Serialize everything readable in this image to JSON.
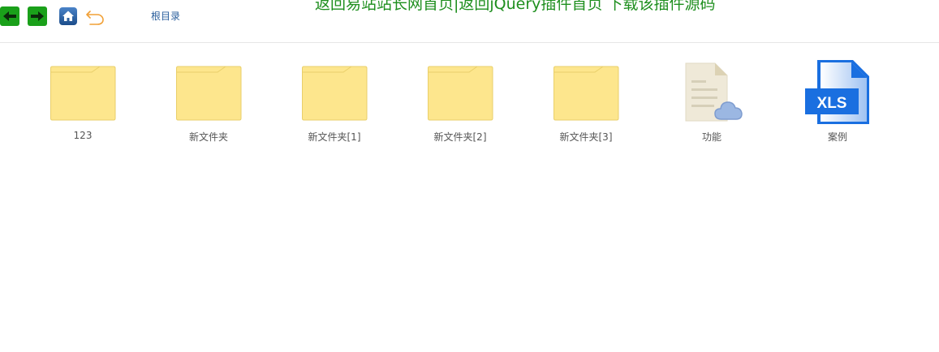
{
  "toolbar": {
    "back_icon": "arrow-left-icon",
    "forward_icon": "arrow-right-icon",
    "home_icon": "home-icon",
    "undo_icon": "undo-icon",
    "root_label": "根目录",
    "accent_green": "#1aa01a",
    "home_blue": "#2a5e9c",
    "undo_orange": "#f1a036"
  },
  "banner": {
    "text": "返回易站站长网首页|返回jQuery插件首页 下载该插件源码"
  },
  "files": [
    {
      "name": "123",
      "type": "folder"
    },
    {
      "name": "新文件夹",
      "type": "folder"
    },
    {
      "name": "新文件夹[1]",
      "type": "folder"
    },
    {
      "name": "新文件夹[2]",
      "type": "folder"
    },
    {
      "name": "新文件夹[3]",
      "type": "folder"
    },
    {
      "name": "功能",
      "type": "cloud-document"
    },
    {
      "name": "案例",
      "type": "xls",
      "badge": "XLS"
    }
  ],
  "colors": {
    "folder_fill": "#fde68d",
    "folder_stroke": "#e9cf6a",
    "xls_blue": "#1a6fe0",
    "cloud_blue": "#8fb0de"
  }
}
